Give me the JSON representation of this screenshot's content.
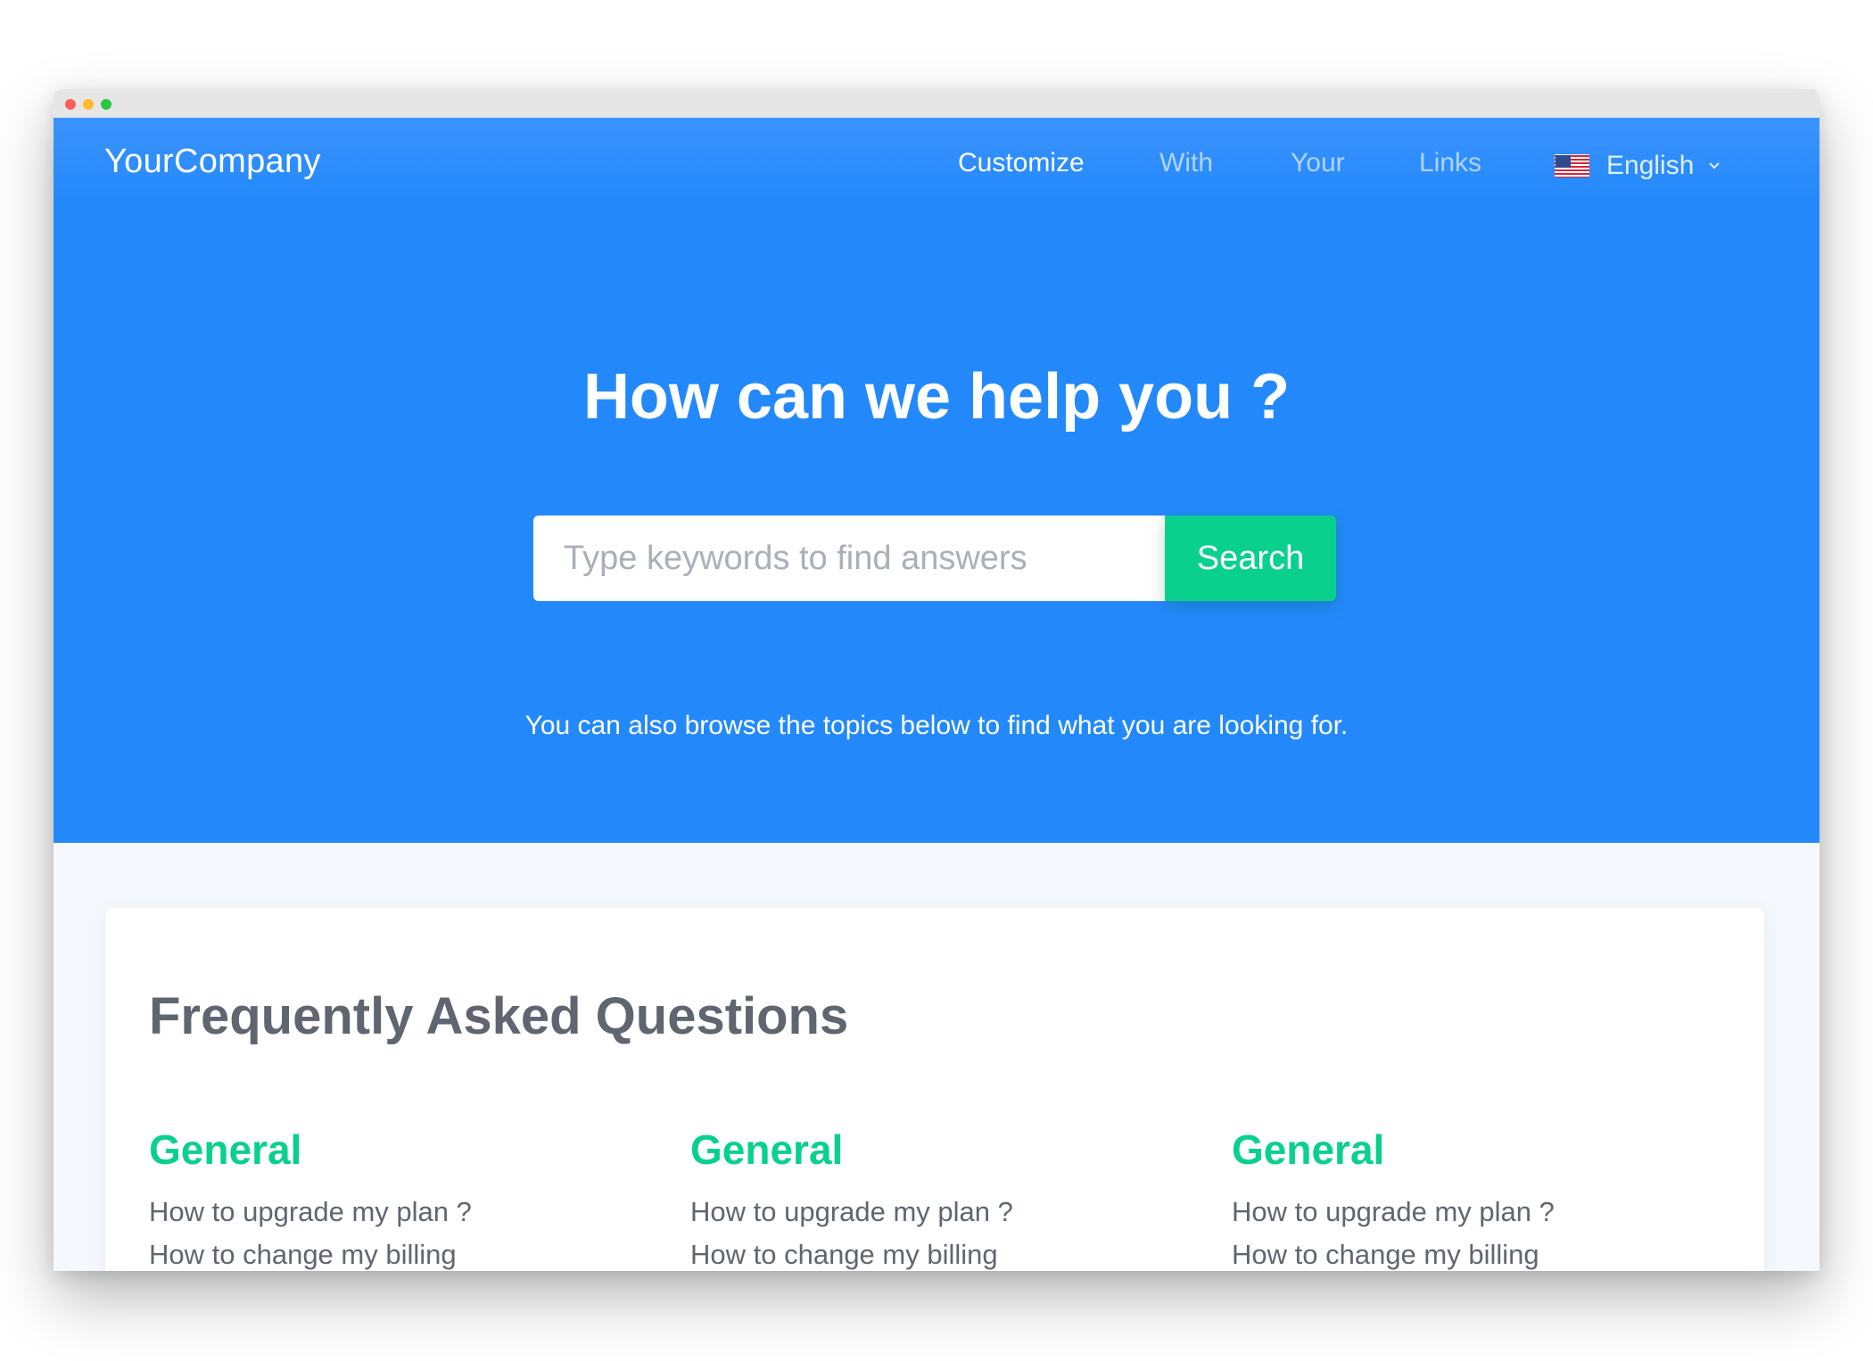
{
  "header": {
    "brand": "YourCompany",
    "nav": [
      "Customize",
      "With",
      "Your",
      "Links"
    ],
    "language": "English"
  },
  "hero": {
    "title": "How can we help you ?",
    "search_placeholder": "Type keywords to find answers",
    "search_button": "Search",
    "subtitle": "You can also browse the topics below to find what you are looking for."
  },
  "faq": {
    "title": "Frequently Asked Questions",
    "columns": [
      {
        "heading": "General",
        "questions": [
          "How to upgrade my plan ?",
          "How to change my billing"
        ]
      },
      {
        "heading": "General",
        "questions": [
          "How to upgrade my plan ?",
          "How to change my billing"
        ]
      },
      {
        "heading": "General",
        "questions": [
          "How to upgrade my plan ?",
          "How to change my billing"
        ]
      }
    ]
  },
  "colors": {
    "hero_blue": "#2389fb",
    "accent_green": "#0ad08e",
    "text_gray": "#5f6670"
  },
  "icons": [
    "us-flag-icon",
    "chevron-down-icon"
  ]
}
